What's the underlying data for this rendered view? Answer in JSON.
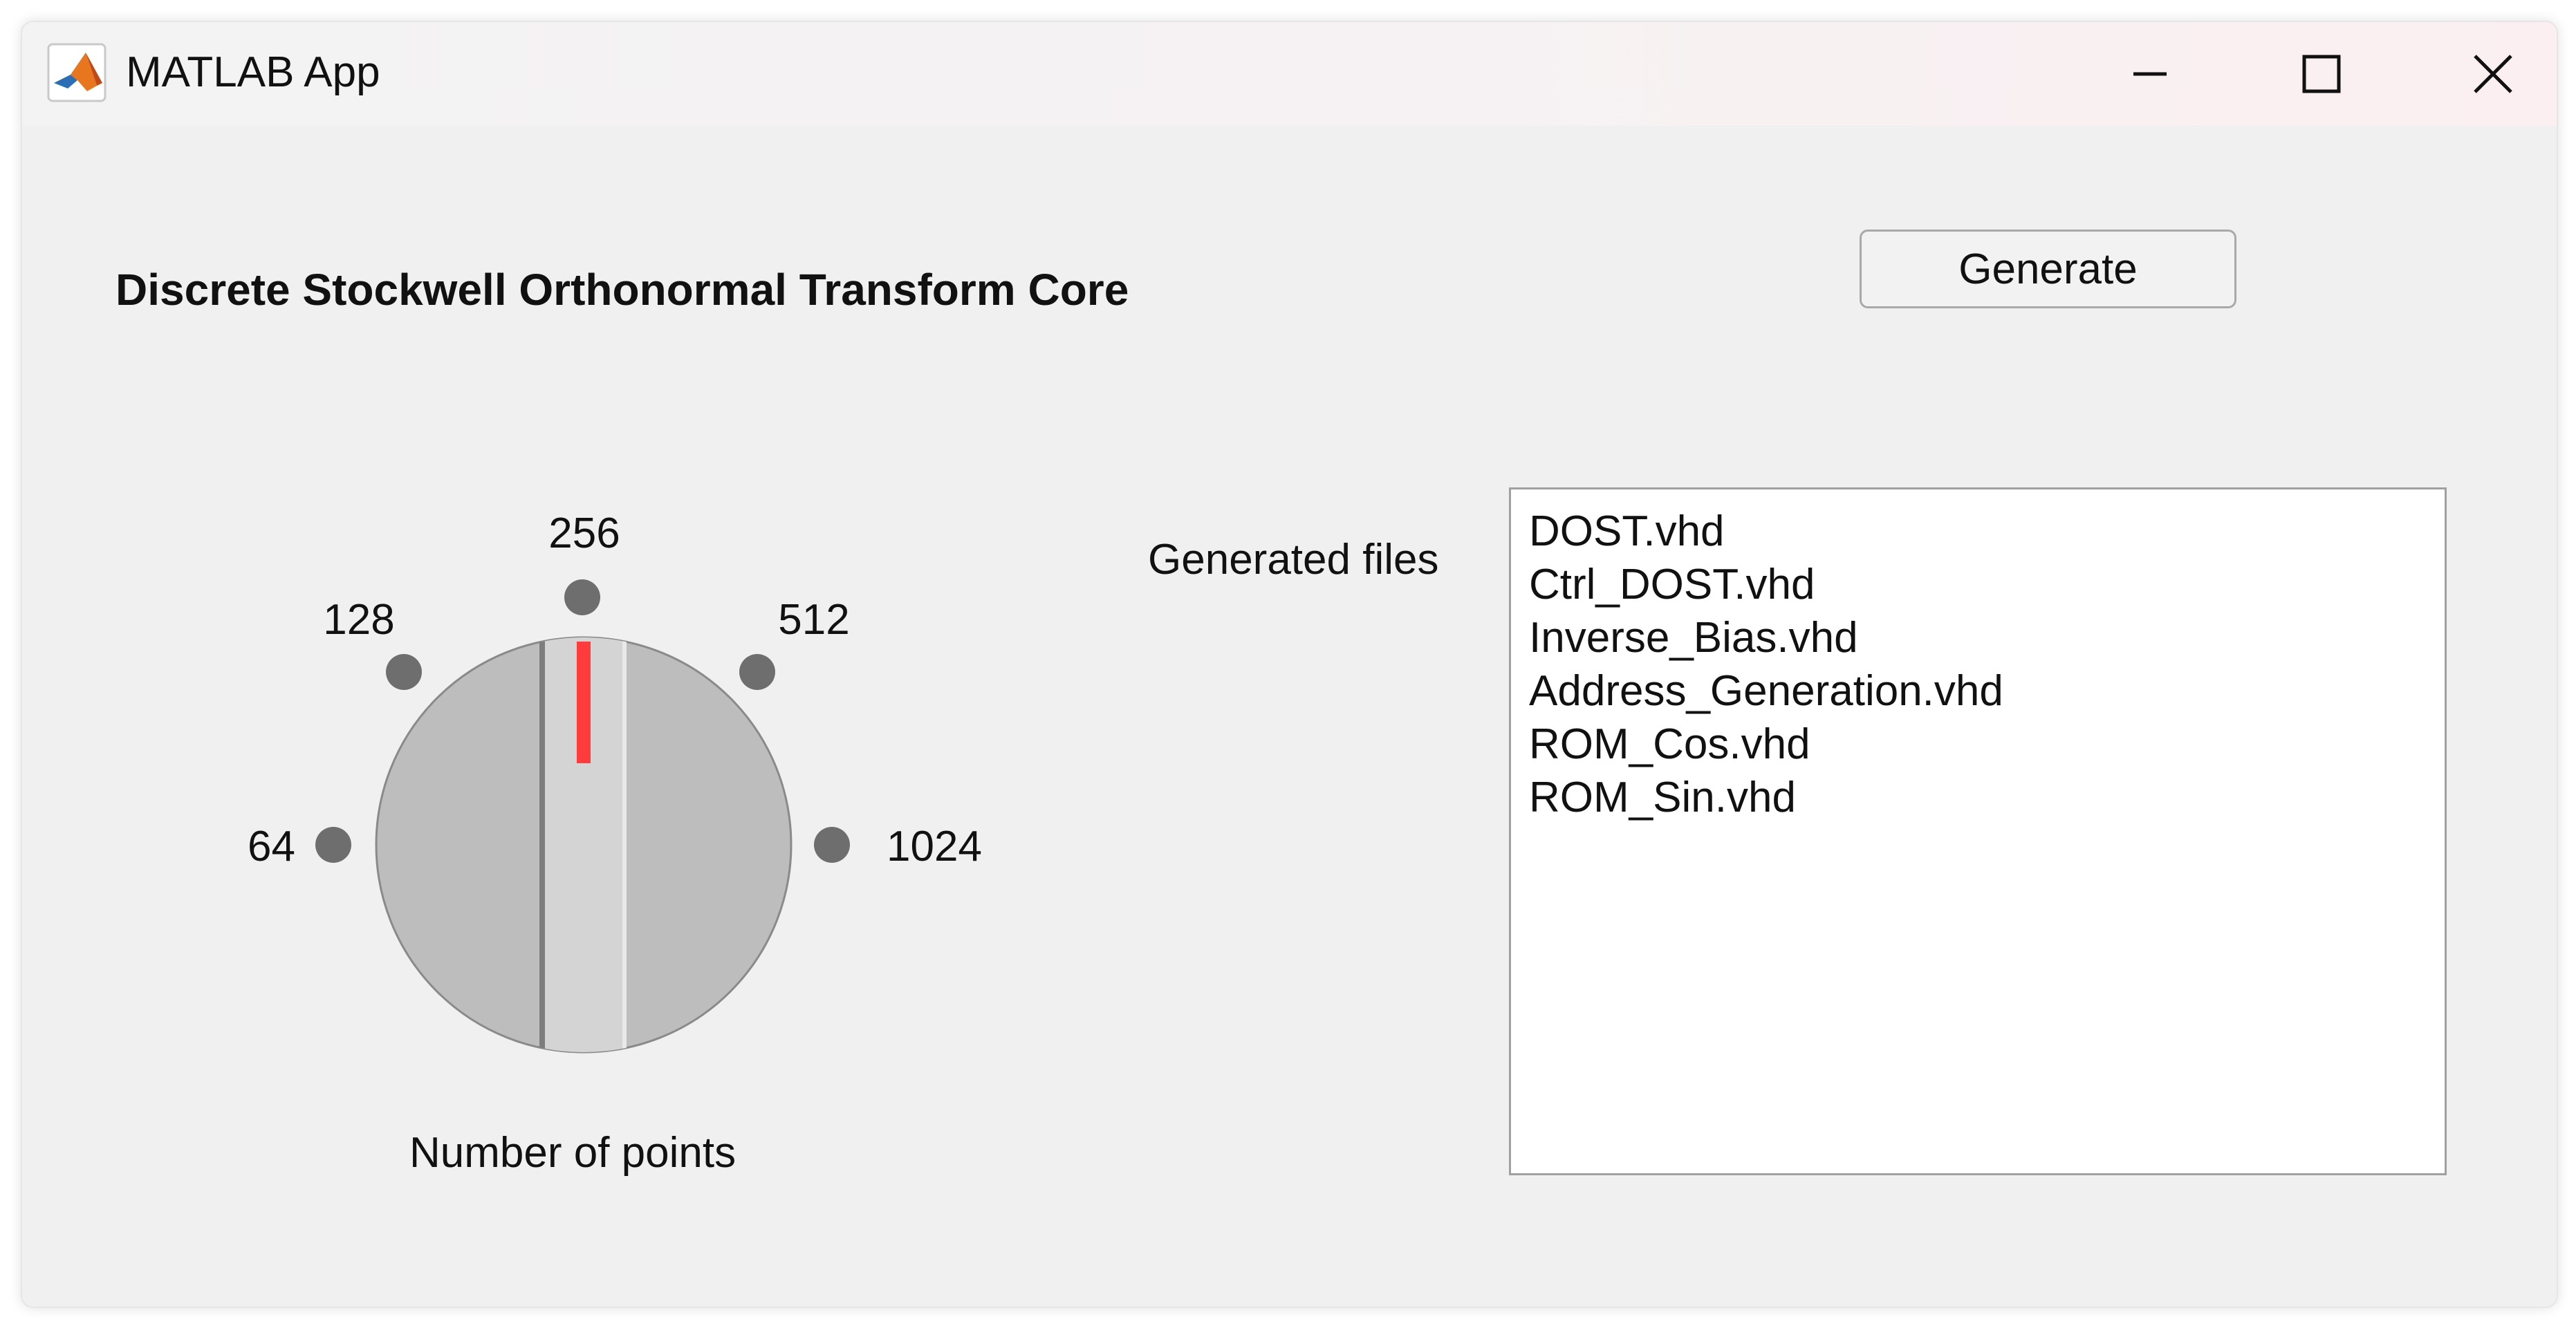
{
  "window": {
    "title": "MATLAB App",
    "icon": "matlab-logo-icon",
    "controls": [
      "minimize-icon",
      "maximize-icon",
      "close-icon"
    ]
  },
  "panel": {
    "title": "Discrete Stockwell Orthonormal Transform Core"
  },
  "toolbar": {
    "generate_label": "Generate"
  },
  "knob": {
    "caption": "Number of points",
    "ticks": [
      "64",
      "128",
      "256",
      "512",
      "1024"
    ],
    "selected": "256",
    "indicator_color": "#ff3b3b"
  },
  "files": {
    "label": "Generated files",
    "items": [
      "DOST.vhd",
      "Ctrl_DOST.vhd",
      "Inverse_Bias.vhd",
      "Address_Generation.vhd",
      "ROM_Cos.vhd",
      "ROM_Sin.vhd"
    ]
  },
  "colors": {
    "window_bg": "#f0f0f0",
    "knob_body": "#bdbdbd",
    "knob_grip": "#d4d4d4",
    "tick_dot": "#6e6e6e"
  }
}
